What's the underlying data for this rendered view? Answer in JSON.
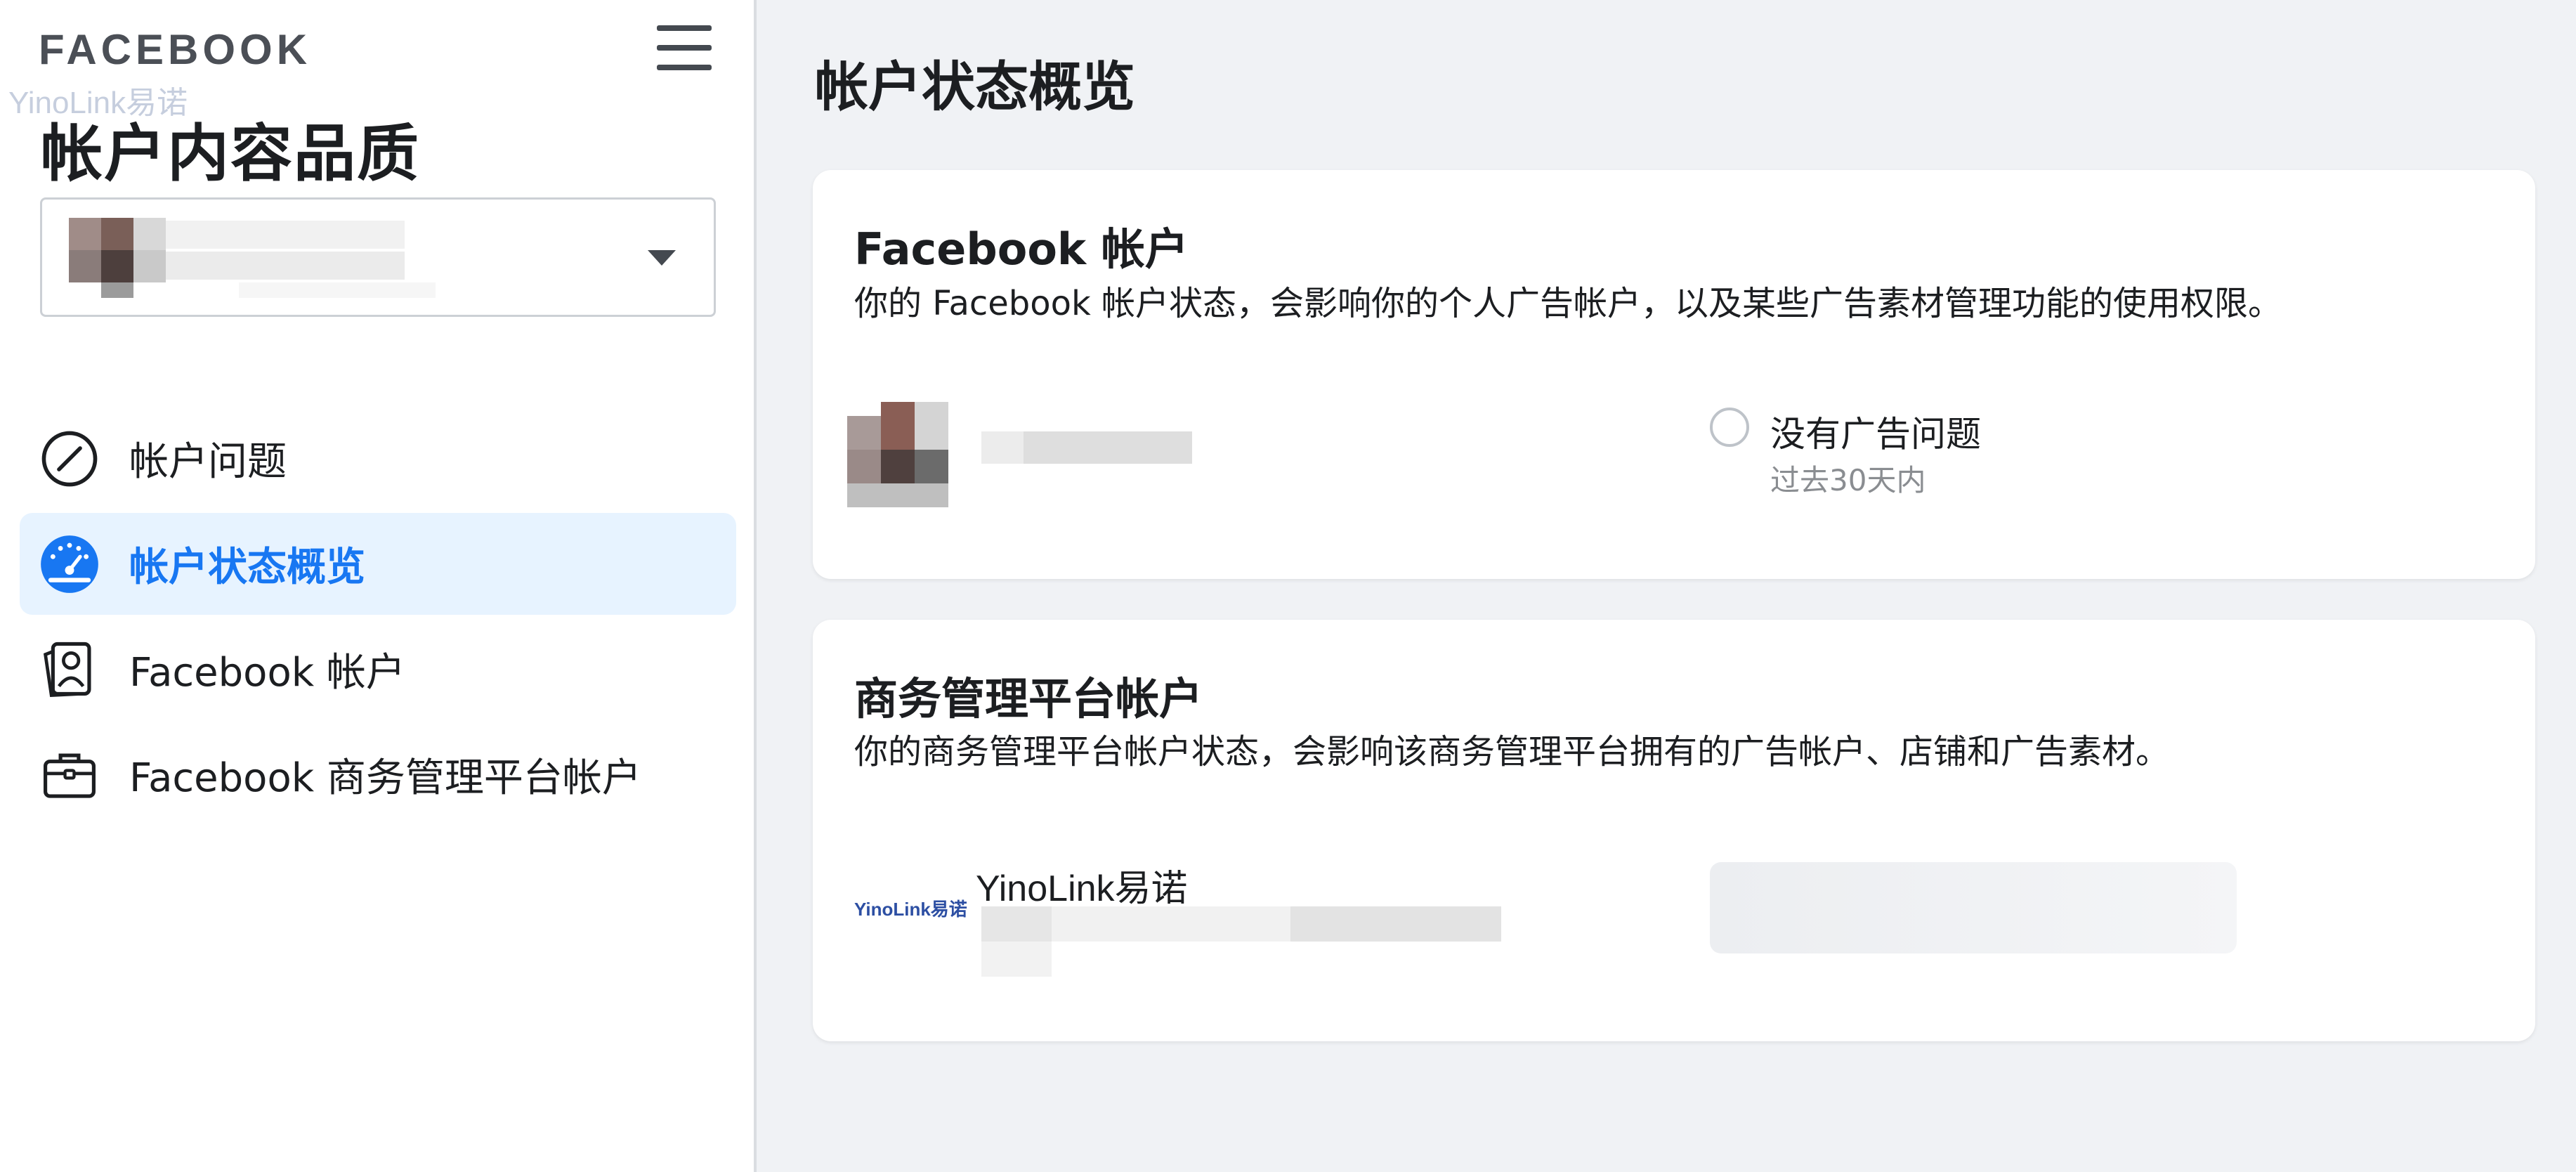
{
  "sidebar": {
    "brand": "FACEBOOK",
    "watermark": "YinoLink易诺",
    "title": "帐户内容品质",
    "items": [
      {
        "label": "帐户问题",
        "icon": "slash-circle-icon"
      },
      {
        "label": "帐户状态概览",
        "icon": "dashboard-gauge-icon",
        "active": true
      },
      {
        "label": "Facebook 帐户",
        "icon": "profile-card-icon"
      },
      {
        "label": "Facebook 商务管理平台帐户",
        "icon": "briefcase-icon"
      }
    ]
  },
  "main": {
    "title": "帐户状态概览",
    "facebook_account": {
      "title": "Facebook 帐户",
      "description": "你的 Facebook 帐户状态，会影响你的个人广告帐户，以及某些广告素材管理功能的使用权限。",
      "status_label": "没有广告问题",
      "status_sub": "过去30天内"
    },
    "business_account": {
      "title": "商务管理平台帐户",
      "description": "你的商务管理平台帐户状态，会影响该商务管理平台拥有的广告帐户、店铺和广告素材。",
      "name": "YinoLink易诺",
      "logo_text": "YinoLink易诺"
    }
  },
  "colors": {
    "accent": "#1877f2",
    "active_bg": "#e7f3ff",
    "page_bg": "#f0f2f5"
  }
}
